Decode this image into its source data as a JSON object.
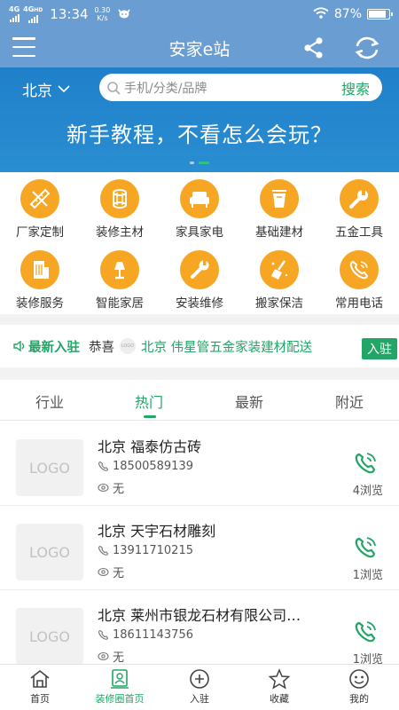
{
  "status_bar": {
    "net1": "4G",
    "net2": "4G",
    "net2_sup": "HD",
    "time": "13:34",
    "speed_value": "0.30",
    "speed_unit": "K/s",
    "battery": "87%",
    "battery_level": 0.87
  },
  "header": {
    "title": "安家e站",
    "menu_icon": "menu-icon",
    "share_icon": "share-icon",
    "refresh_icon": "refresh-icon"
  },
  "banner": {
    "city": "北京",
    "search_placeholder": "手机/分类/品牌",
    "search_button": "搜索",
    "promo_text": "新手教程，不看怎么会玩？"
  },
  "categories": [
    {
      "label": "厂家定制",
      "icon": "ruler-pencil-icon"
    },
    {
      "label": "装修主材",
      "icon": "pipes-icon"
    },
    {
      "label": "家具家电",
      "icon": "sofa-icon"
    },
    {
      "label": "基础建材",
      "icon": "paint-bucket-icon"
    },
    {
      "label": "五金工具",
      "icon": "wrench-icon"
    },
    {
      "label": "装修服务",
      "icon": "building-icon"
    },
    {
      "label": "智能家居",
      "icon": "lamp-icon"
    },
    {
      "label": "安装维修",
      "icon": "tools-icon"
    },
    {
      "label": "搬家保洁",
      "icon": "broom-icon"
    },
    {
      "label": "常用电话",
      "icon": "phone-icon"
    }
  ],
  "ticker": {
    "label": "最新入驻",
    "congrats": "恭喜",
    "logo_text": "LOGO",
    "news": "北京 伟星管五金家装建材配送",
    "join_button": "入驻"
  },
  "tabs": [
    {
      "label": "行业"
    },
    {
      "label": "热门"
    },
    {
      "label": "最新"
    },
    {
      "label": "附近"
    }
  ],
  "active_tab": "热门",
  "listings": [
    {
      "logo": "LOGO",
      "title": "北京 福泰仿古砖",
      "phone": "18500589139",
      "address": "无",
      "views": "4浏览"
    },
    {
      "logo": "LOGO",
      "title": "北京 天宇石材雕刻",
      "phone": "13911710215",
      "address": "无",
      "views": "1浏览"
    },
    {
      "logo": "LOGO",
      "title": "北京 莱州市银龙石材有限公司…",
      "phone": "18611143756",
      "address": "无",
      "views": "1浏览"
    }
  ],
  "bottom_nav": [
    {
      "label": "首页",
      "icon": "home-icon"
    },
    {
      "label": "装修圈首页",
      "icon": "portrait-icon"
    },
    {
      "label": "入驻",
      "icon": "plus-circle-icon"
    },
    {
      "label": "收藏",
      "icon": "star-icon"
    },
    {
      "label": "我的",
      "icon": "smiley-icon"
    }
  ],
  "colors": {
    "header": "#6a9ed3",
    "banner": "#1f80c9",
    "accent": "#22a567",
    "category_icon": "#f6a623"
  }
}
